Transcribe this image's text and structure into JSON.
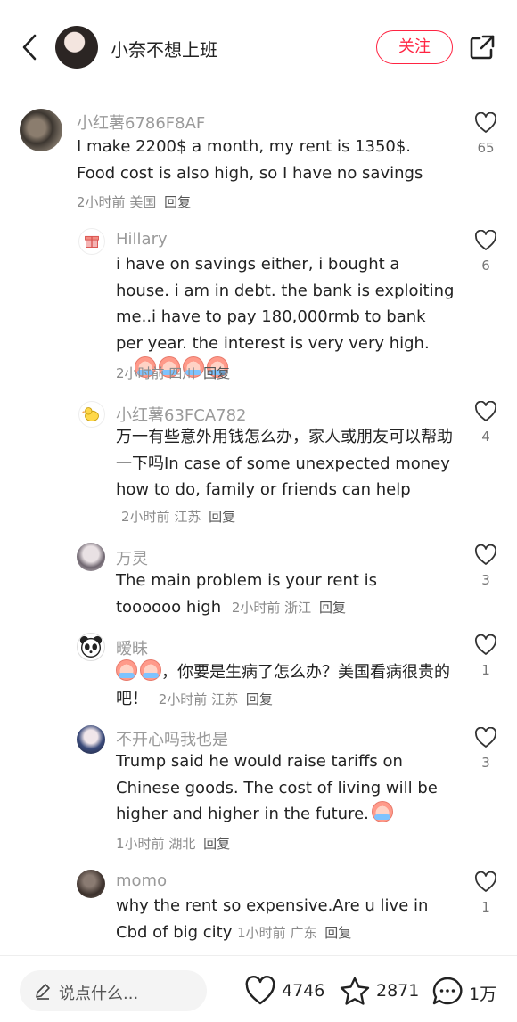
{
  "header": {
    "title": "小奈不想上班",
    "follow_label": "关注"
  },
  "comments": [
    {
      "name": "小红薯6786F8AF",
      "text": "I make 2200$ a month, my rent is 1350$. Food cost is also high, so I have no savings",
      "time": "2小时前",
      "location": "美国",
      "reply": "回复",
      "likes": "65"
    },
    {
      "name": "Hillary",
      "text": "i have on savings either, i bought a house. i am in debt. the bank is exploiting me..i have to pay 180,000rmb to bank per year. the interest is very very high.",
      "time": "2小时前",
      "location": "四川",
      "reply": "回复",
      "likes": "6"
    },
    {
      "name": "小红薯63FCA782",
      "text": "万一有些意外用钱怎么办，家人或朋友可以帮助一下吗In case of some unexpected money how to do, family or friends can help",
      "time": "2小时前",
      "location": "江苏",
      "reply": "回复",
      "likes": "4"
    },
    {
      "name": "万灵",
      "text": "The main problem is your rent is toooooo high",
      "time": "2小时前",
      "location": "浙江",
      "reply": "回复",
      "likes": "3"
    },
    {
      "name": "暧昧",
      "text": "，你要是生病了怎么办？美国看病很贵的吧！",
      "time": "2小时前",
      "location": "江苏",
      "reply": "回复",
      "likes": "1"
    },
    {
      "name": "不开心吗我也是",
      "text": "Trump said he would raise tariffs on Chinese goods. The cost of living will be higher and higher in the future.",
      "time": "1小时前",
      "location": "湖北",
      "reply": "回复",
      "likes": "3"
    },
    {
      "name": "momo",
      "text": "why the rent so expensive.Are u live in Cbd of big city",
      "time": "1小时前",
      "location": "广东",
      "reply": "回复",
      "likes": "1"
    }
  ],
  "bottom": {
    "input_placeholder": "说点什么...",
    "likes": "4746",
    "collects": "2871",
    "comments": "1万"
  },
  "colors": {
    "accent": "#ff2442",
    "secondary_text": "#9a9a9a"
  }
}
